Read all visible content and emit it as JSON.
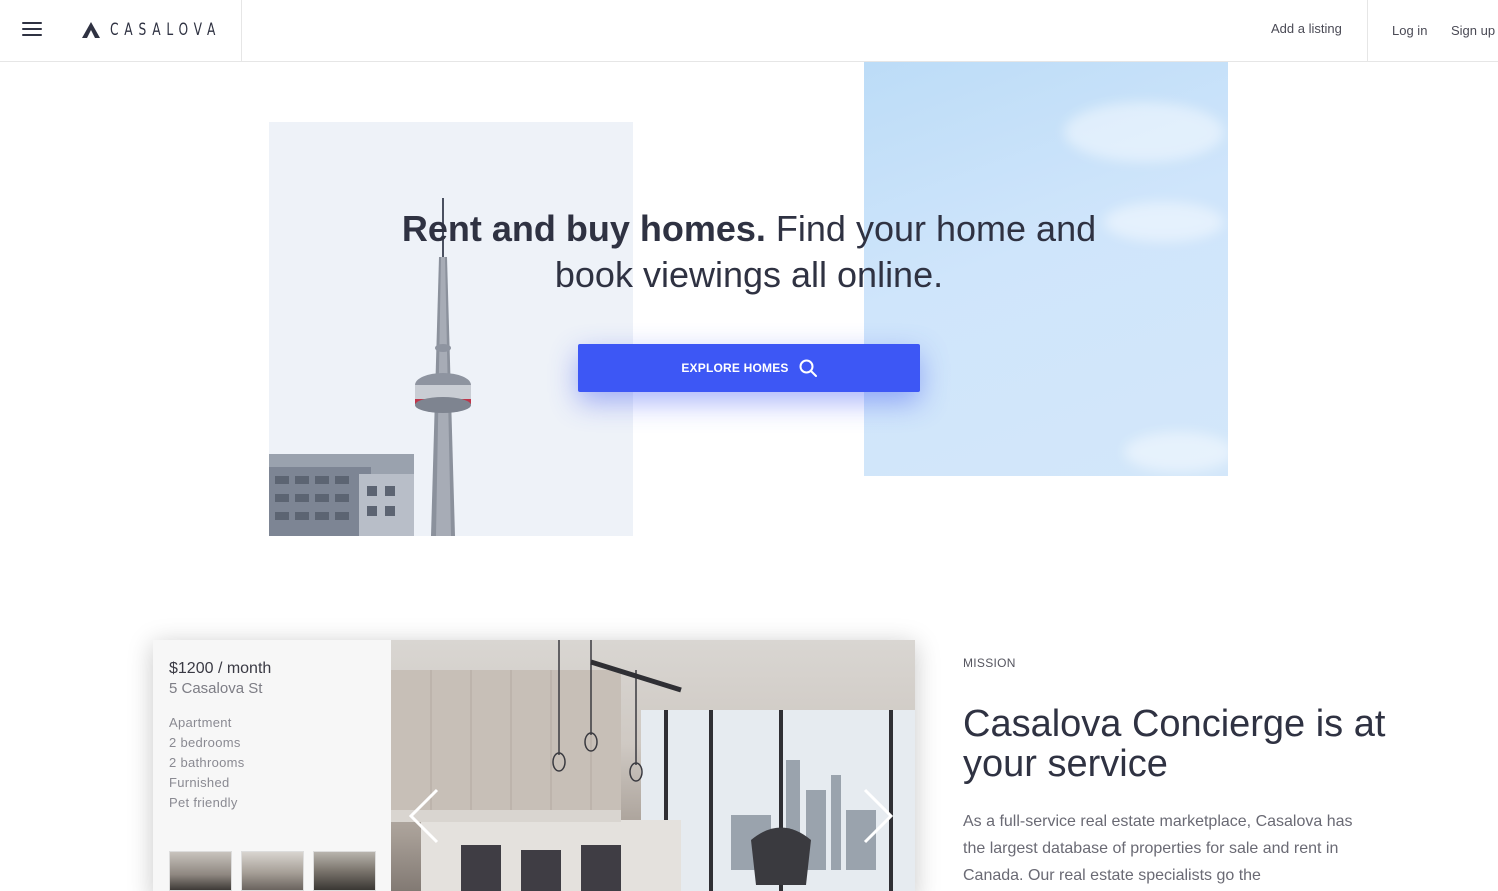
{
  "header": {
    "logo_text": "CASALOVA",
    "add_listing": "Add a listing",
    "login": "Log in",
    "signup": "Sign up"
  },
  "hero": {
    "title_bold": "Rent and buy homes.",
    "title_rest": " Find your home and book viewings all online.",
    "cta_label": "EXPLORE HOMES",
    "cta_color": "#3d57f5"
  },
  "listing": {
    "price": "$1200 / month",
    "address": "5 Casalova St",
    "features": [
      "Apartment",
      "2 bedrooms",
      "2 bathrooms",
      "Furnished",
      "Pet friendly"
    ]
  },
  "mission": {
    "label": "MISSION",
    "title": "Casalova Concierge is at your service",
    "text": "As a full-service real estate marketplace, Casalova has the largest database of properties for sale and rent in Canada. Our real estate specialists go the"
  },
  "icons": {
    "menu": "hamburger-menu-icon",
    "logo": "casalova-logo-icon",
    "search": "search-icon",
    "prev": "chevron-left-icon",
    "next": "chevron-right-icon"
  }
}
